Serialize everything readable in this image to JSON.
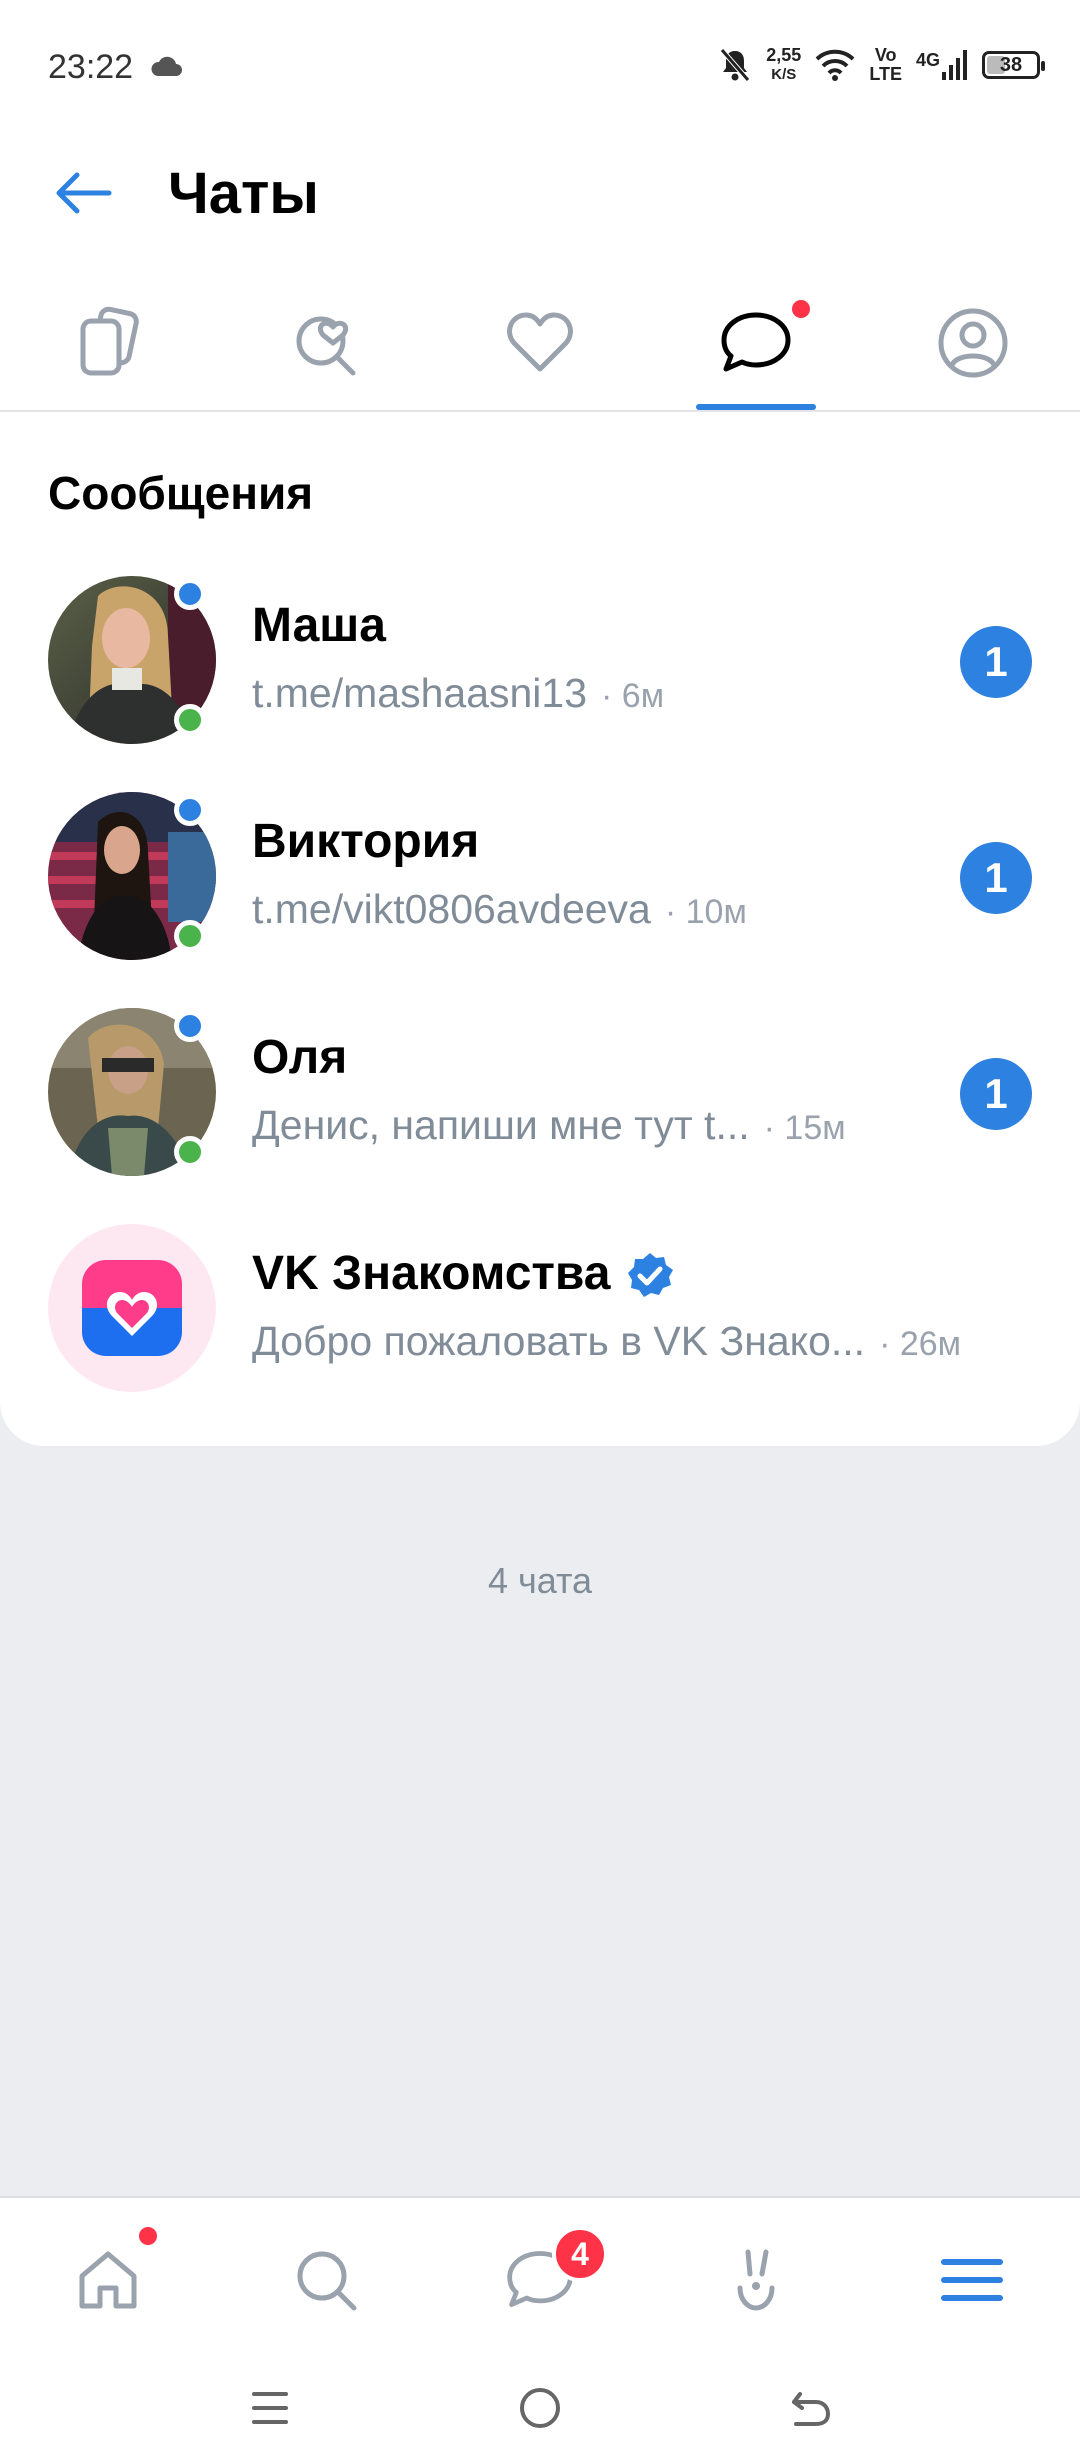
{
  "status_bar": {
    "time": "23:22",
    "speed_value": "2,55",
    "speed_unit": "K/S",
    "volte_top": "Vo",
    "volte_bottom": "LTE",
    "network": "4G",
    "battery": "38",
    "battery_level": 0.38
  },
  "header": {
    "title": "Чаты",
    "back_icon": "arrow-left-icon"
  },
  "tabs": [
    {
      "icon": "cards-icon",
      "active": false
    },
    {
      "icon": "search-heart-icon",
      "active": false
    },
    {
      "icon": "heart-icon",
      "active": false
    },
    {
      "icon": "chat-bubble-icon",
      "active": true,
      "has_dot": true
    },
    {
      "icon": "profile-icon",
      "active": false
    }
  ],
  "section": {
    "title": "Сообщения"
  },
  "chats": [
    {
      "name": "Маша",
      "preview": "t.me/mashaasni13",
      "time": "6м",
      "unread": "1"
    },
    {
      "name": "Виктория",
      "preview": "t.me/vikt0806avdeeva",
      "time": "10м",
      "unread": "1"
    },
    {
      "name": "Оля",
      "preview": "Денис, напиши мне тут t...",
      "time": "15м",
      "unread": "1"
    },
    {
      "name": "VK Знакомства",
      "preview": "Добро пожаловать в VK Знако...",
      "time": "26м",
      "verified": true
    }
  ],
  "footer": {
    "chats_count": "4 чата"
  },
  "bottom_nav": {
    "items": [
      "home-icon",
      "search-icon",
      "messages-icon",
      "bunny-icon",
      "menu-icon"
    ],
    "messages_badge": "4"
  },
  "colors": {
    "accent": "#2d81e0",
    "badge": "#ff3347",
    "online": "#4bb34b",
    "secondary_text": "#818c99"
  }
}
